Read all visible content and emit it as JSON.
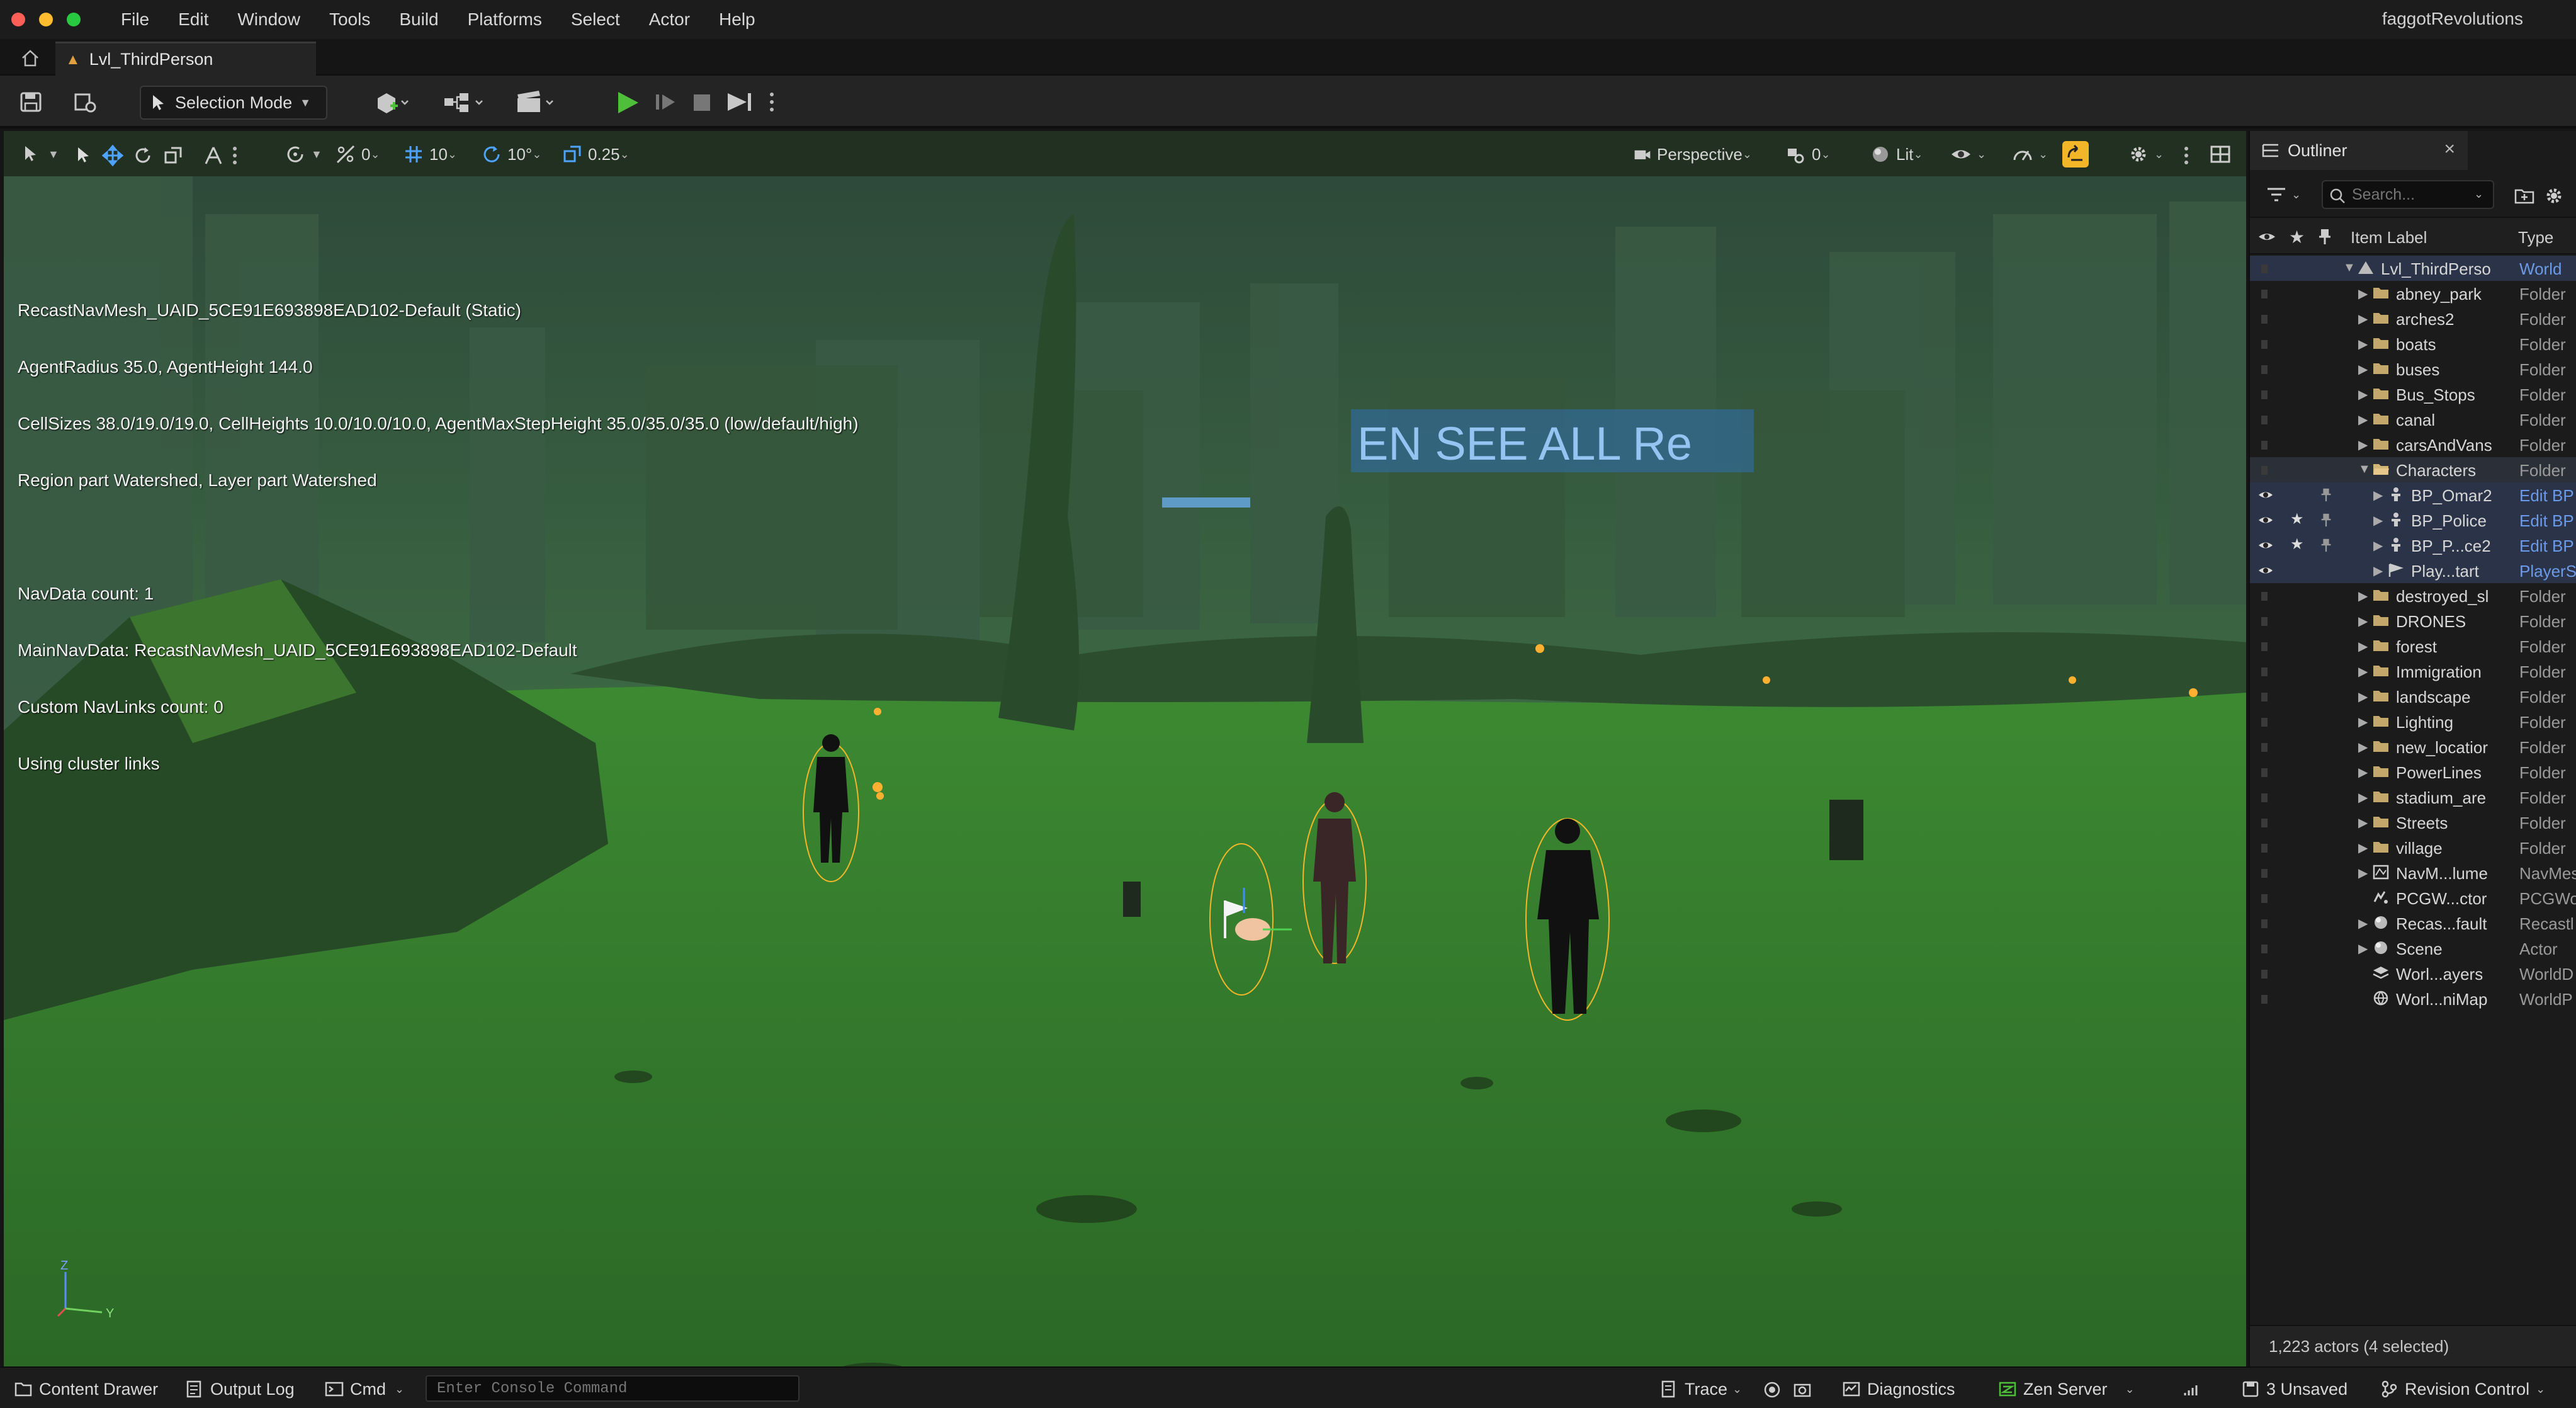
{
  "menubar": {
    "items": [
      "File",
      "Edit",
      "Window",
      "Tools",
      "Build",
      "Platforms",
      "Select",
      "Actor",
      "Help"
    ],
    "project_name": "faggotRevolutions"
  },
  "tabs": {
    "level_name": "Lvl_ThirdPerson"
  },
  "toolbar": {
    "selection_mode": "Selection Mode",
    "icons": [
      "save-icon",
      "source-control-icon",
      "add-actor-icon",
      "blueprint-icon",
      "cinematics-icon",
      "play-icon",
      "advance-frame-icon",
      "stop-icon",
      "eject-icon",
      "more-options-icon"
    ]
  },
  "viewport": {
    "toolbar": {
      "rotation_snap_value": "0",
      "grid_snap_value": "10",
      "angle_snap_value": "10°",
      "scale_snap_value": "0.25",
      "view_type": "Perspective",
      "camera_speed": "0",
      "view_mode": "Lit"
    },
    "debug_lines": [
      "RecastNavMesh_UAID_5CE91E693898EAD102-Default (Static)",
      "AgentRadius 35.0, AgentHeight 144.0",
      "CellSizes 38.0/19.0/19.0, CellHeights 10.0/10.0/10.0, AgentMaxStepHeight 35.0/35.0/35.0 (low/default/high)",
      "Region part Watershed, Layer part Watershed",
      "",
      "NavData count: 1",
      "MainNavData: RecastNavMesh_UAID_5CE91E693898EAD102-Default",
      "Custom NavLinks count: 0",
      "Using cluster links"
    ],
    "billboard_text": "EN SEE ALL  Re",
    "axis_labels": [
      "Z",
      "Y"
    ]
  },
  "outliner": {
    "tab_title": "Outliner",
    "close_glyph": "×",
    "search_placeholder": "Search...",
    "col_label": "Item Label",
    "col_type": "Type",
    "rows": [
      {
        "label": "Lvl_ThirdPerso",
        "type": "World",
        "indent": 0,
        "icon": "level",
        "expander": "▼",
        "state": "sel",
        "eye": false,
        "star": false,
        "pin": false
      },
      {
        "label": "abney_park",
        "type": "Folder",
        "indent": 1,
        "icon": "folder",
        "expander": "▶",
        "state": "",
        "eye": false,
        "star": false,
        "pin": false
      },
      {
        "label": "arches2",
        "type": "Folder",
        "indent": 1,
        "icon": "folder",
        "expander": "▶",
        "state": "",
        "eye": false,
        "star": false,
        "pin": false
      },
      {
        "label": "boats",
        "type": "Folder",
        "indent": 1,
        "icon": "folder",
        "expander": "▶",
        "state": "",
        "eye": false,
        "star": false,
        "pin": false
      },
      {
        "label": "buses",
        "type": "Folder",
        "indent": 1,
        "icon": "folder",
        "expander": "▶",
        "state": "",
        "eye": false,
        "star": false,
        "pin": false
      },
      {
        "label": "Bus_Stops",
        "type": "Folder",
        "indent": 1,
        "icon": "folder",
        "expander": "▶",
        "state": "",
        "eye": false,
        "star": false,
        "pin": false
      },
      {
        "label": "canal",
        "type": "Folder",
        "indent": 1,
        "icon": "folder",
        "expander": "▶",
        "state": "",
        "eye": false,
        "star": false,
        "pin": false
      },
      {
        "label": "carsAndVans",
        "type": "Folder",
        "indent": 1,
        "icon": "folder",
        "expander": "▶",
        "state": "",
        "eye": false,
        "star": false,
        "pin": false
      },
      {
        "label": "Characters",
        "type": "Folder",
        "indent": 1,
        "icon": "folder-open",
        "expander": "▼",
        "state": "chars",
        "eye": false,
        "star": false,
        "pin": false
      },
      {
        "label": "BP_Omar2",
        "type": "Edit BP",
        "indent": 2,
        "icon": "pawn",
        "expander": "▶",
        "state": "sel",
        "eye": true,
        "star": false,
        "pin": true
      },
      {
        "label": "BP_Police",
        "type": "Edit BP",
        "indent": 2,
        "icon": "pawn",
        "expander": "▶",
        "state": "sel",
        "eye": true,
        "star": true,
        "pin": true
      },
      {
        "label": "BP_P...ce2",
        "type": "Edit BP",
        "indent": 2,
        "icon": "pawn",
        "expander": "▶",
        "state": "sel",
        "eye": true,
        "star": true,
        "pin": true
      },
      {
        "label": "Play...tart",
        "type": "PlayerS",
        "indent": 2,
        "icon": "player-start",
        "expander": "▶",
        "state": "sel",
        "eye": true,
        "star": false,
        "pin": false
      },
      {
        "label": "destroyed_sl",
        "type": "Folder",
        "indent": 1,
        "icon": "folder",
        "expander": "▶",
        "state": "",
        "eye": false,
        "star": false,
        "pin": false
      },
      {
        "label": "DRONES",
        "type": "Folder",
        "indent": 1,
        "icon": "folder",
        "expander": "▶",
        "state": "",
        "eye": false,
        "star": false,
        "pin": false
      },
      {
        "label": "forest",
        "type": "Folder",
        "indent": 1,
        "icon": "folder",
        "expander": "▶",
        "state": "",
        "eye": false,
        "star": false,
        "pin": false
      },
      {
        "label": "Immigration",
        "type": "Folder",
        "indent": 1,
        "icon": "folder",
        "expander": "▶",
        "state": "",
        "eye": false,
        "star": false,
        "pin": false
      },
      {
        "label": "landscape",
        "type": "Folder",
        "indent": 1,
        "icon": "folder",
        "expander": "▶",
        "state": "",
        "eye": false,
        "star": false,
        "pin": false
      },
      {
        "label": "Lighting",
        "type": "Folder",
        "indent": 1,
        "icon": "folder",
        "expander": "▶",
        "state": "",
        "eye": false,
        "star": false,
        "pin": false
      },
      {
        "label": "new_locatior",
        "type": "Folder",
        "indent": 1,
        "icon": "folder",
        "expander": "▶",
        "state": "",
        "eye": false,
        "star": false,
        "pin": false
      },
      {
        "label": "PowerLines",
        "type": "Folder",
        "indent": 1,
        "icon": "folder",
        "expander": "▶",
        "state": "",
        "eye": false,
        "star": false,
        "pin": false
      },
      {
        "label": "stadium_are",
        "type": "Folder",
        "indent": 1,
        "icon": "folder",
        "expander": "▶",
        "state": "",
        "eye": false,
        "star": false,
        "pin": false
      },
      {
        "label": "Streets",
        "type": "Folder",
        "indent": 1,
        "icon": "folder",
        "expander": "▶",
        "state": "",
        "eye": false,
        "star": false,
        "pin": false
      },
      {
        "label": "village",
        "type": "Folder",
        "indent": 1,
        "icon": "folder",
        "expander": "▶",
        "state": "",
        "eye": false,
        "star": false,
        "pin": false
      },
      {
        "label": "NavM...lume",
        "type": "NavMes",
        "indent": 1,
        "icon": "navmesh",
        "expander": "▶",
        "state": "",
        "eye": false,
        "star": false,
        "pin": false
      },
      {
        "label": "PCGW...ctor",
        "type": "PCGWo",
        "indent": 1,
        "icon": "pcg",
        "expander": "",
        "state": "",
        "eye": false,
        "star": false,
        "pin": false
      },
      {
        "label": "Recas...fault",
        "type": "Recastl",
        "indent": 1,
        "icon": "actor",
        "expander": "▶",
        "state": "",
        "eye": false,
        "star": false,
        "pin": false
      },
      {
        "label": "Scene",
        "type": "Actor",
        "indent": 1,
        "icon": "actor",
        "expander": "▶",
        "state": "",
        "eye": false,
        "star": false,
        "pin": false
      },
      {
        "label": "Worl...ayers",
        "type": "WorldD",
        "indent": 1,
        "icon": "layers",
        "expander": "",
        "state": "",
        "eye": false,
        "star": false,
        "pin": false
      },
      {
        "label": "Worl...niMap",
        "type": "WorldP",
        "indent": 1,
        "icon": "globe",
        "expander": "",
        "state": "",
        "eye": false,
        "star": false,
        "pin": false
      }
    ],
    "footer": "1,223 actors (4 selected)"
  },
  "statusbar": {
    "content_drawer": "Content Drawer",
    "output_log": "Output Log",
    "cmd": "Cmd",
    "console_placeholder": "Enter Console Command",
    "trace": "Trace",
    "diagnostics": "Diagnostics",
    "zen_server": "Zen Server",
    "unsaved": "3 Unsaved",
    "revision_control": "Revision Control"
  },
  "colors": {
    "accent_blue": "#6b9ae8",
    "play_green": "#4fbf3b",
    "selection_row": "#2a3347",
    "ground_green": "#2f6f2a",
    "highlight_orange": "#f2b628"
  }
}
